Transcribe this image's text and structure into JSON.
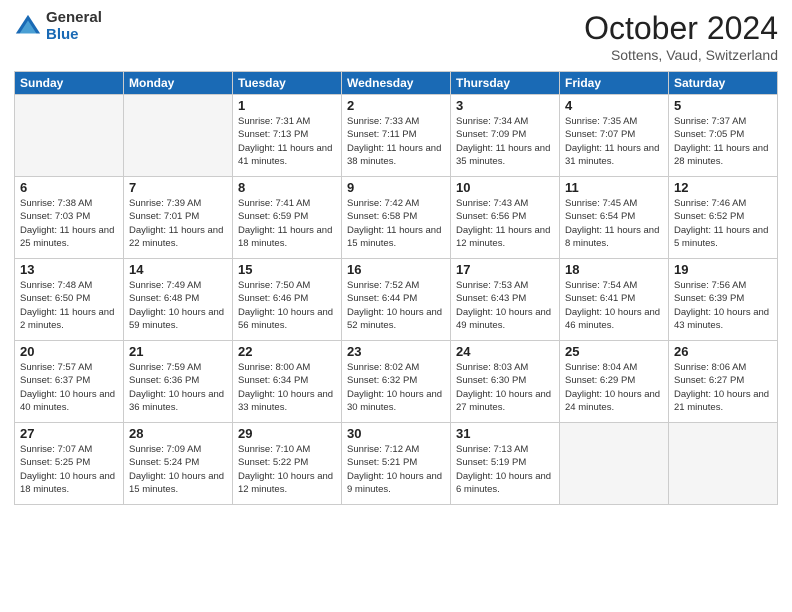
{
  "logo": {
    "general": "General",
    "blue": "Blue"
  },
  "title": "October 2024",
  "location": "Sottens, Vaud, Switzerland",
  "days_of_week": [
    "Sunday",
    "Monday",
    "Tuesday",
    "Wednesday",
    "Thursday",
    "Friday",
    "Saturday"
  ],
  "weeks": [
    [
      {
        "day": "",
        "info": ""
      },
      {
        "day": "",
        "info": ""
      },
      {
        "day": "1",
        "info": "Sunrise: 7:31 AM\nSunset: 7:13 PM\nDaylight: 11 hours and 41 minutes."
      },
      {
        "day": "2",
        "info": "Sunrise: 7:33 AM\nSunset: 7:11 PM\nDaylight: 11 hours and 38 minutes."
      },
      {
        "day": "3",
        "info": "Sunrise: 7:34 AM\nSunset: 7:09 PM\nDaylight: 11 hours and 35 minutes."
      },
      {
        "day": "4",
        "info": "Sunrise: 7:35 AM\nSunset: 7:07 PM\nDaylight: 11 hours and 31 minutes."
      },
      {
        "day": "5",
        "info": "Sunrise: 7:37 AM\nSunset: 7:05 PM\nDaylight: 11 hours and 28 minutes."
      }
    ],
    [
      {
        "day": "6",
        "info": "Sunrise: 7:38 AM\nSunset: 7:03 PM\nDaylight: 11 hours and 25 minutes."
      },
      {
        "day": "7",
        "info": "Sunrise: 7:39 AM\nSunset: 7:01 PM\nDaylight: 11 hours and 22 minutes."
      },
      {
        "day": "8",
        "info": "Sunrise: 7:41 AM\nSunset: 6:59 PM\nDaylight: 11 hours and 18 minutes."
      },
      {
        "day": "9",
        "info": "Sunrise: 7:42 AM\nSunset: 6:58 PM\nDaylight: 11 hours and 15 minutes."
      },
      {
        "day": "10",
        "info": "Sunrise: 7:43 AM\nSunset: 6:56 PM\nDaylight: 11 hours and 12 minutes."
      },
      {
        "day": "11",
        "info": "Sunrise: 7:45 AM\nSunset: 6:54 PM\nDaylight: 11 hours and 8 minutes."
      },
      {
        "day": "12",
        "info": "Sunrise: 7:46 AM\nSunset: 6:52 PM\nDaylight: 11 hours and 5 minutes."
      }
    ],
    [
      {
        "day": "13",
        "info": "Sunrise: 7:48 AM\nSunset: 6:50 PM\nDaylight: 11 hours and 2 minutes."
      },
      {
        "day": "14",
        "info": "Sunrise: 7:49 AM\nSunset: 6:48 PM\nDaylight: 10 hours and 59 minutes."
      },
      {
        "day": "15",
        "info": "Sunrise: 7:50 AM\nSunset: 6:46 PM\nDaylight: 10 hours and 56 minutes."
      },
      {
        "day": "16",
        "info": "Sunrise: 7:52 AM\nSunset: 6:44 PM\nDaylight: 10 hours and 52 minutes."
      },
      {
        "day": "17",
        "info": "Sunrise: 7:53 AM\nSunset: 6:43 PM\nDaylight: 10 hours and 49 minutes."
      },
      {
        "day": "18",
        "info": "Sunrise: 7:54 AM\nSunset: 6:41 PM\nDaylight: 10 hours and 46 minutes."
      },
      {
        "day": "19",
        "info": "Sunrise: 7:56 AM\nSunset: 6:39 PM\nDaylight: 10 hours and 43 minutes."
      }
    ],
    [
      {
        "day": "20",
        "info": "Sunrise: 7:57 AM\nSunset: 6:37 PM\nDaylight: 10 hours and 40 minutes."
      },
      {
        "day": "21",
        "info": "Sunrise: 7:59 AM\nSunset: 6:36 PM\nDaylight: 10 hours and 36 minutes."
      },
      {
        "day": "22",
        "info": "Sunrise: 8:00 AM\nSunset: 6:34 PM\nDaylight: 10 hours and 33 minutes."
      },
      {
        "day": "23",
        "info": "Sunrise: 8:02 AM\nSunset: 6:32 PM\nDaylight: 10 hours and 30 minutes."
      },
      {
        "day": "24",
        "info": "Sunrise: 8:03 AM\nSunset: 6:30 PM\nDaylight: 10 hours and 27 minutes."
      },
      {
        "day": "25",
        "info": "Sunrise: 8:04 AM\nSunset: 6:29 PM\nDaylight: 10 hours and 24 minutes."
      },
      {
        "day": "26",
        "info": "Sunrise: 8:06 AM\nSunset: 6:27 PM\nDaylight: 10 hours and 21 minutes."
      }
    ],
    [
      {
        "day": "27",
        "info": "Sunrise: 7:07 AM\nSunset: 5:25 PM\nDaylight: 10 hours and 18 minutes."
      },
      {
        "day": "28",
        "info": "Sunrise: 7:09 AM\nSunset: 5:24 PM\nDaylight: 10 hours and 15 minutes."
      },
      {
        "day": "29",
        "info": "Sunrise: 7:10 AM\nSunset: 5:22 PM\nDaylight: 10 hours and 12 minutes."
      },
      {
        "day": "30",
        "info": "Sunrise: 7:12 AM\nSunset: 5:21 PM\nDaylight: 10 hours and 9 minutes."
      },
      {
        "day": "31",
        "info": "Sunrise: 7:13 AM\nSunset: 5:19 PM\nDaylight: 10 hours and 6 minutes."
      },
      {
        "day": "",
        "info": ""
      },
      {
        "day": "",
        "info": ""
      }
    ]
  ]
}
